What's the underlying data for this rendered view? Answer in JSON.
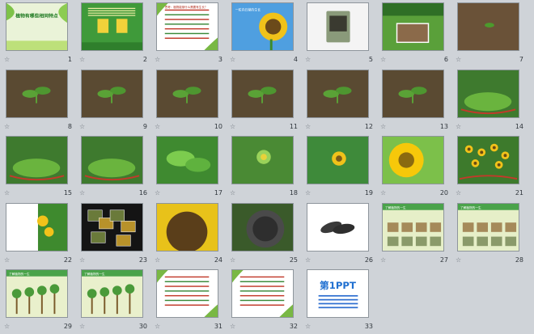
{
  "window": {
    "title": ""
  },
  "slides": [
    {
      "n": "1",
      "kind": "title",
      "title": "植物有哪些相同特点",
      "subtitle": ""
    },
    {
      "n": "2",
      "kind": "text-green",
      "title": "",
      "subtitle": ""
    },
    {
      "n": "3",
      "kind": "text-white",
      "title": "思考：植物能够什么需要有生长？",
      "subtitle": ""
    },
    {
      "n": "4",
      "kind": "sky-sunflower",
      "title": "一粒向日葵的生长",
      "subtitle": ""
    },
    {
      "n": "5",
      "kind": "seeds-bag",
      "title": "",
      "subtitle": ""
    },
    {
      "n": "6",
      "kind": "garden-plot",
      "title": "",
      "subtitle": ""
    },
    {
      "n": "7",
      "kind": "soil-sprout",
      "title": "",
      "subtitle": ""
    },
    {
      "n": "8",
      "kind": "seedling",
      "title": "",
      "subtitle": ""
    },
    {
      "n": "9",
      "kind": "seedling",
      "title": "",
      "subtitle": ""
    },
    {
      "n": "10",
      "kind": "seedling",
      "title": "",
      "subtitle": ""
    },
    {
      "n": "11",
      "kind": "seedling",
      "title": "",
      "subtitle": ""
    },
    {
      "n": "12",
      "kind": "seedling",
      "title": "",
      "subtitle": ""
    },
    {
      "n": "13",
      "kind": "seedling",
      "title": "",
      "subtitle": ""
    },
    {
      "n": "14",
      "kind": "bed",
      "title": "",
      "subtitle": ""
    },
    {
      "n": "15",
      "kind": "bed",
      "title": "",
      "subtitle": ""
    },
    {
      "n": "16",
      "kind": "bed",
      "title": "",
      "subtitle": ""
    },
    {
      "n": "17",
      "kind": "leaves",
      "title": "",
      "subtitle": ""
    },
    {
      "n": "18",
      "kind": "bud",
      "title": "",
      "subtitle": ""
    },
    {
      "n": "19",
      "kind": "bud-open",
      "title": "",
      "subtitle": ""
    },
    {
      "n": "20",
      "kind": "flower",
      "title": "",
      "subtitle": ""
    },
    {
      "n": "21",
      "kind": "field",
      "title": "",
      "subtitle": ""
    },
    {
      "n": "22",
      "kind": "sunflowers-white",
      "title": "",
      "subtitle": ""
    },
    {
      "n": "23",
      "kind": "collage-dark",
      "title": "",
      "subtitle": ""
    },
    {
      "n": "24",
      "kind": "seedhead",
      "title": "",
      "subtitle": ""
    },
    {
      "n": "25",
      "kind": "seedhead-dark",
      "title": "",
      "subtitle": ""
    },
    {
      "n": "26",
      "kind": "seeds-white",
      "title": "",
      "subtitle": ""
    },
    {
      "n": "27",
      "kind": "lifecycle",
      "title": "了解植物的一生",
      "subtitle": ""
    },
    {
      "n": "28",
      "kind": "lifecycle",
      "title": "了解植物的一生",
      "subtitle": ""
    },
    {
      "n": "29",
      "kind": "lifecycle-tree",
      "title": "了解植物的一生",
      "subtitle": ""
    },
    {
      "n": "30",
      "kind": "lifecycle-tree",
      "title": "了解植物的一生",
      "subtitle": ""
    },
    {
      "n": "31",
      "kind": "text-white",
      "title": "",
      "subtitle": ""
    },
    {
      "n": "32",
      "kind": "text-white",
      "title": "",
      "subtitle": ""
    },
    {
      "n": "33",
      "kind": "logo",
      "title": "第1PPT",
      "subtitle": ""
    }
  ],
  "colors": {
    "panel": "#cfd3d8",
    "border": "#8e959c",
    "number": "#30363c",
    "star": "#6d747b"
  },
  "icons": {
    "slide_marker": "star-icon"
  },
  "star_glyph": "☆"
}
